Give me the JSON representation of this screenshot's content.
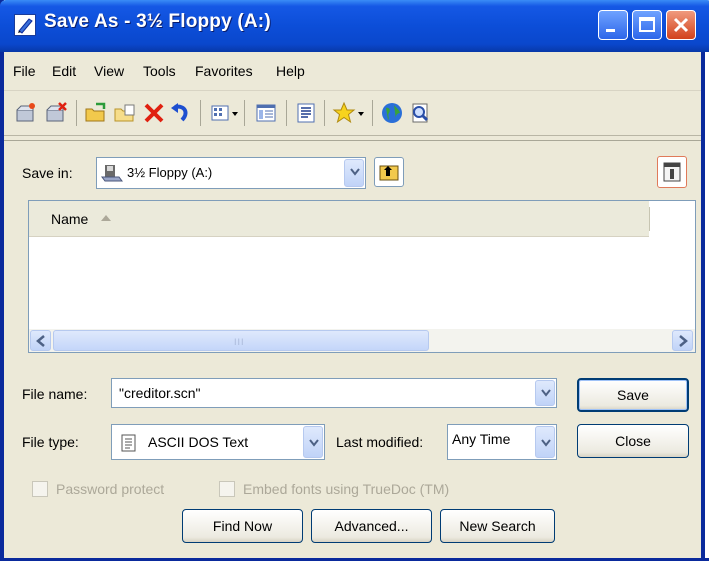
{
  "window": {
    "title": "Save As - 3½ Floppy (A:)"
  },
  "menu": [
    "File",
    "Edit",
    "View",
    "Tools",
    "Favorites",
    "Help"
  ],
  "toolbar_icons": [
    "new-folder-icon",
    "delete-folder-icon",
    "open-folder-icon",
    "open-icon",
    "delete-icon",
    "undo-icon",
    "views-icon",
    "properties-icon",
    "preview-icon",
    "favorites-icon",
    "globe-icon",
    "search-icon"
  ],
  "save_in": {
    "label": "Save in:",
    "value": "3½ Floppy (A:)"
  },
  "list": {
    "column_header": "Name",
    "scroll_grip": "III"
  },
  "file_name": {
    "label": "File name:",
    "value": "\"creditor.scn\""
  },
  "file_type": {
    "label": "File type:",
    "value": "ASCII DOS Text"
  },
  "last_modified": {
    "label": "Last modified:",
    "value": "Any Time"
  },
  "buttons": {
    "save": "Save",
    "close": "Close",
    "find_now": "Find Now",
    "advanced": "Advanced...",
    "new_search": "New Search"
  },
  "options": {
    "password_protect": "Password protect",
    "embed_fonts": "Embed fonts using TrueDoc (TM)"
  },
  "colors": {
    "titlebar": "#0c4ed8",
    "frame": "#0a2a9c",
    "face": "#ece9d8",
    "close_button": "#d2421c"
  }
}
